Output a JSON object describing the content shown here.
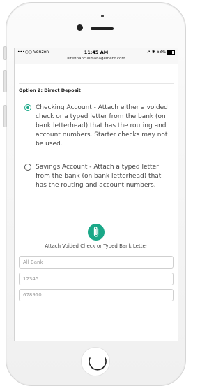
{
  "status_bar": {
    "carrier": "•••○○ Verizon",
    "time": "11:45 AM",
    "battery": "63%",
    "url": "ilifefinancialmanagement.com"
  },
  "section": {
    "title": "Option 2: Direct Deposit"
  },
  "options": [
    {
      "selected": true,
      "text": "Checking Account - Attach either a voided check or a typed letter from the bank (on bank letterhead) that has the routing and account numbers. Starter checks may not be used."
    },
    {
      "selected": false,
      "text": "Savings Account - Attach a typed letter from the bank (on bank letterhead) that has the routing and account numbers."
    }
  ],
  "attach": {
    "icon": "paperclip-icon",
    "label": "Attach Voided Check or Typed Bank Letter"
  },
  "fields": [
    {
      "placeholder": "All Bank"
    },
    {
      "placeholder": "12345"
    },
    {
      "placeholder": "678910"
    }
  ],
  "colors": {
    "accent": "#1aa888"
  }
}
